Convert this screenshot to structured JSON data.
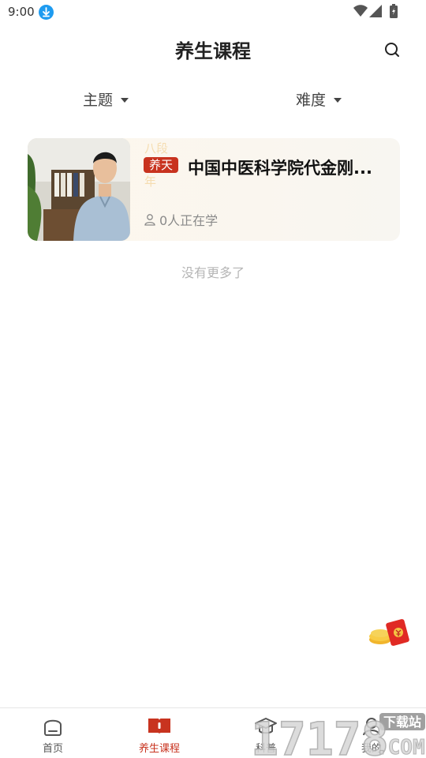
{
  "status_bar": {
    "time": "9:00",
    "icons": [
      "download-icon",
      "wifi-icon",
      "signal-icon",
      "battery-icon"
    ]
  },
  "header": {
    "title": "养生课程",
    "search_icon": "search-icon"
  },
  "filters": [
    {
      "label": "主题"
    },
    {
      "label": "难度"
    }
  ],
  "courses": [
    {
      "tag": "养天",
      "tag_ghost_top": "八段",
      "tag_ghost_bottom": "年",
      "title": "中国中医科学院代金刚...",
      "learners": "0人正在学"
    }
  ],
  "list_end_text": "没有更多了",
  "bottom_nav": [
    {
      "label": "首页",
      "icon": "home-icon",
      "active": false
    },
    {
      "label": "养生课程",
      "icon": "course-book-icon",
      "active": true
    },
    {
      "label": "科普",
      "icon": "graduation-cap-icon",
      "active": false
    },
    {
      "label": "我的",
      "icon": "user-icon",
      "active": false
    }
  ],
  "watermark": {
    "text": "17178",
    "suffix": ".COM",
    "badge": "下载站"
  },
  "colors": {
    "accent": "#c8331f",
    "card_bg": "#fdf7ec",
    "muted": "#b5b5b5"
  }
}
